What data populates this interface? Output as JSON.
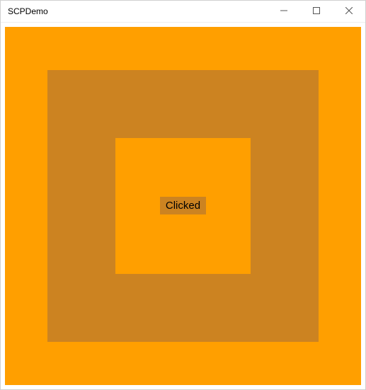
{
  "window": {
    "title": "SCPDemo"
  },
  "colors": {
    "outer": "#ff9f00",
    "middle": "#cc8321",
    "inner": "#ff9f00",
    "button": "#cc8321"
  },
  "button": {
    "label": "Clicked"
  }
}
